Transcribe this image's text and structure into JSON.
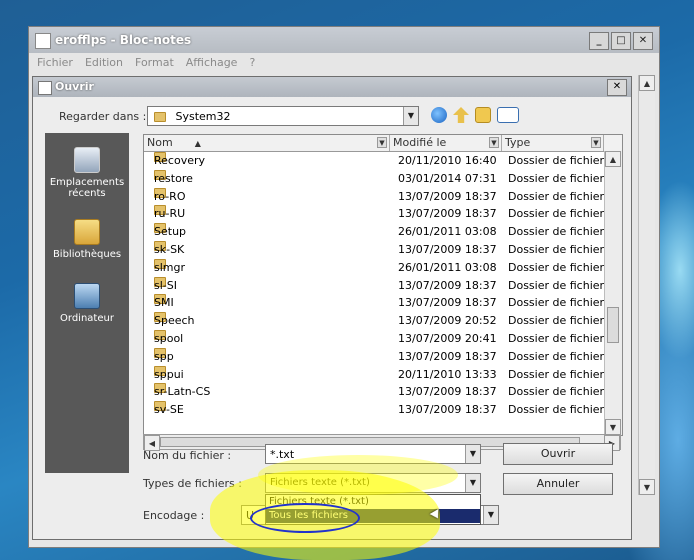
{
  "notepad": {
    "title": "erofflps - Bloc-notes",
    "menu": [
      "Fichier",
      "Edition",
      "Format",
      "Affichage",
      "?"
    ],
    "controls": {
      "minimize": "_",
      "maximize": "□",
      "close": "✕"
    }
  },
  "dialog": {
    "title": "Ouvrir",
    "close": "✕",
    "look_in_label": "Regarder dans :",
    "look_in_value": "System32",
    "places": [
      {
        "label": "Emplacements récents",
        "icon": "recent-places-icon"
      },
      {
        "label": "Bibliothèques",
        "icon": "libraries-icon"
      },
      {
        "label": "Ordinateur",
        "icon": "computer-icon"
      }
    ],
    "columns": {
      "name": "Nom",
      "modified": "Modifié le",
      "type": "Type"
    },
    "files": [
      {
        "name": "Recovery",
        "date": "20/11/2010 16:40",
        "type": "Dossier de fichiers"
      },
      {
        "name": "restore",
        "date": "03/01/2014 07:31",
        "type": "Dossier de fichiers"
      },
      {
        "name": "ro-RO",
        "date": "13/07/2009 18:37",
        "type": "Dossier de fichiers"
      },
      {
        "name": "ru-RU",
        "date": "13/07/2009 18:37",
        "type": "Dossier de fichiers"
      },
      {
        "name": "Setup",
        "date": "26/01/2011 03:08",
        "type": "Dossier de fichiers"
      },
      {
        "name": "sk-SK",
        "date": "13/07/2009 18:37",
        "type": "Dossier de fichiers"
      },
      {
        "name": "slmgr",
        "date": "26/01/2011 03:08",
        "type": "Dossier de fichiers"
      },
      {
        "name": "sl-SI",
        "date": "13/07/2009 18:37",
        "type": "Dossier de fichiers"
      },
      {
        "name": "SMI",
        "date": "13/07/2009 18:37",
        "type": "Dossier de fichiers"
      },
      {
        "name": "Speech",
        "date": "13/07/2009 20:52",
        "type": "Dossier de fichiers"
      },
      {
        "name": "spool",
        "date": "13/07/2009 20:41",
        "type": "Dossier de fichiers"
      },
      {
        "name": "spp",
        "date": "13/07/2009 18:37",
        "type": "Dossier de fichiers"
      },
      {
        "name": "sppui",
        "date": "20/11/2010 13:33",
        "type": "Dossier de fichiers"
      },
      {
        "name": "sr-Latn-CS",
        "date": "13/07/2009 18:37",
        "type": "Dossier de fichiers"
      },
      {
        "name": "sv-SE",
        "date": "13/07/2009 18:37",
        "type": "Dossier de fichiers"
      }
    ],
    "filename_label": "Nom du fichier :",
    "filename_value": "*.txt",
    "filetype_label": "Types de fichiers :",
    "filetype_value": "Fichiers texte (*.txt)",
    "filetype_options": [
      "Fichiers texte (*.txt)",
      "Tous les fichiers"
    ],
    "filetype_selected": "Tous les fichiers",
    "encoding_label": "Encodage :",
    "encoding_value": "U",
    "open_button": "Ouvrir",
    "cancel_button": "Annuler"
  },
  "colors": {
    "highlight": "#ffff00",
    "selection": "#1a2b6d",
    "desktop": "#1c6aa8"
  }
}
